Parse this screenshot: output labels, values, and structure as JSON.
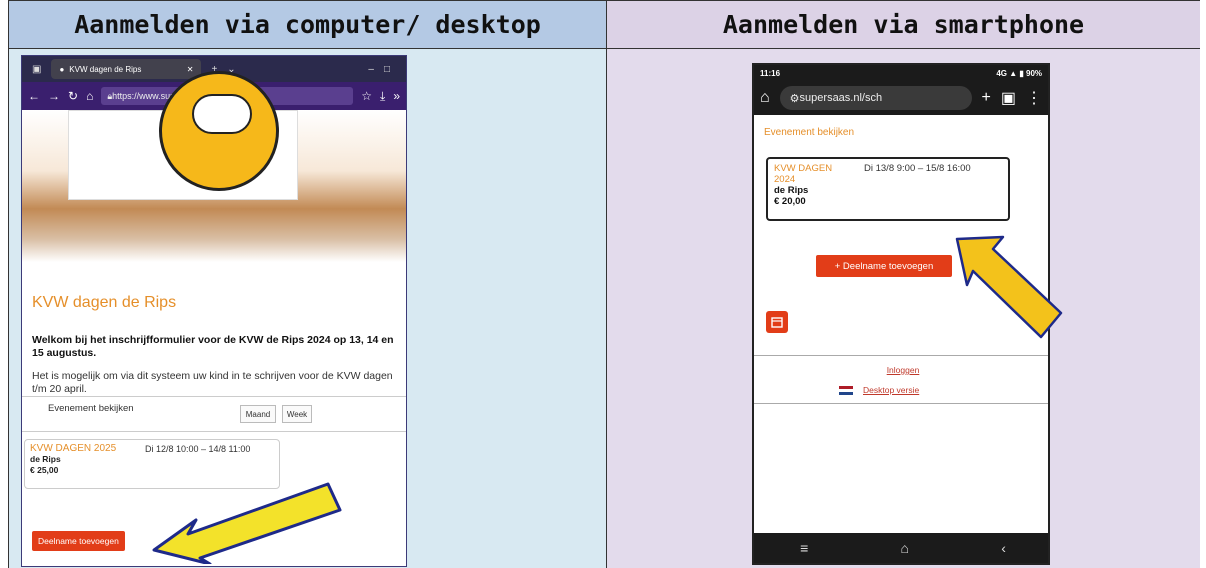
{
  "headers": {
    "desktop": "Aanmelden via computer/ desktop",
    "smartphone": "Aanmelden via smartphone"
  },
  "desktop": {
    "tab_title": "KVW dagen de Rips",
    "url": "https://www.supersaas.nl",
    "page_title": "KVW dagen de Rips",
    "intro_bold": "Welkom bij het inschrijfformulier voor de KVW de Rips 2024 op 13, 14 en 15 augustus.",
    "intro_text": "Het is mogelijk om via dit systeem uw kind in te schrijven voor de KVW dagen t/m 20 april.",
    "event_view": "Evenement bekijken",
    "month_button": "Maand",
    "week_button": "Week",
    "event_title": "KVW DAGEN 2025",
    "event_dates": "Di 12/8  10:00 – 14/8 11:00",
    "event_place": "de Rips",
    "event_price": "€ 25,00",
    "add_button": "Deelname toevoegen"
  },
  "phone": {
    "time": "11:16",
    "status_right": "4G ▲ ▮ 90%",
    "url": "supersaas.nl/sch",
    "event_view": "Evenement bekijken",
    "event_title": "KVW DAGEN 2024",
    "event_dates": "Di 13/8  9:00 – 15/8 16:00",
    "event_place": "de Rips",
    "event_price": "€ 20,00",
    "add_button": "+ Deelname toevoegen",
    "login": "Inloggen",
    "desktop_version": "Desktop versie"
  },
  "colors": {
    "accent_orange": "#e58f2a",
    "button_red": "#e23d18",
    "arrow_yellow": "#f3c21b"
  }
}
